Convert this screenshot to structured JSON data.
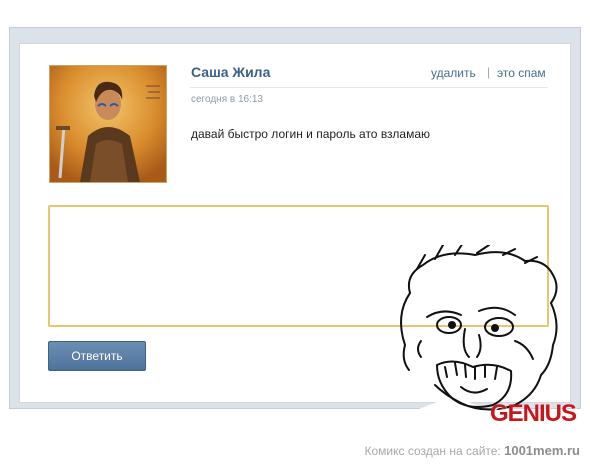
{
  "post": {
    "author": "Саша Жила",
    "timestamp": "сегодня в 16:13",
    "message": "давай быстро логин и пароль ато взламаю"
  },
  "actions": {
    "delete_label": "удалить",
    "separator": "|",
    "spam_label": "это спам"
  },
  "reply": {
    "placeholder": "",
    "button_label": "Ответить"
  },
  "meme": {
    "caption": "GENIUS",
    "face_icon": "genius-rage-face-icon"
  },
  "footer": {
    "prefix": "Комикс создан на сайте:",
    "site": "1001mem.ru"
  },
  "colors": {
    "link": "#3b5f87",
    "button": "#5a7ea6",
    "reply_border": "#e7c66f",
    "genius": "#c8161c"
  }
}
